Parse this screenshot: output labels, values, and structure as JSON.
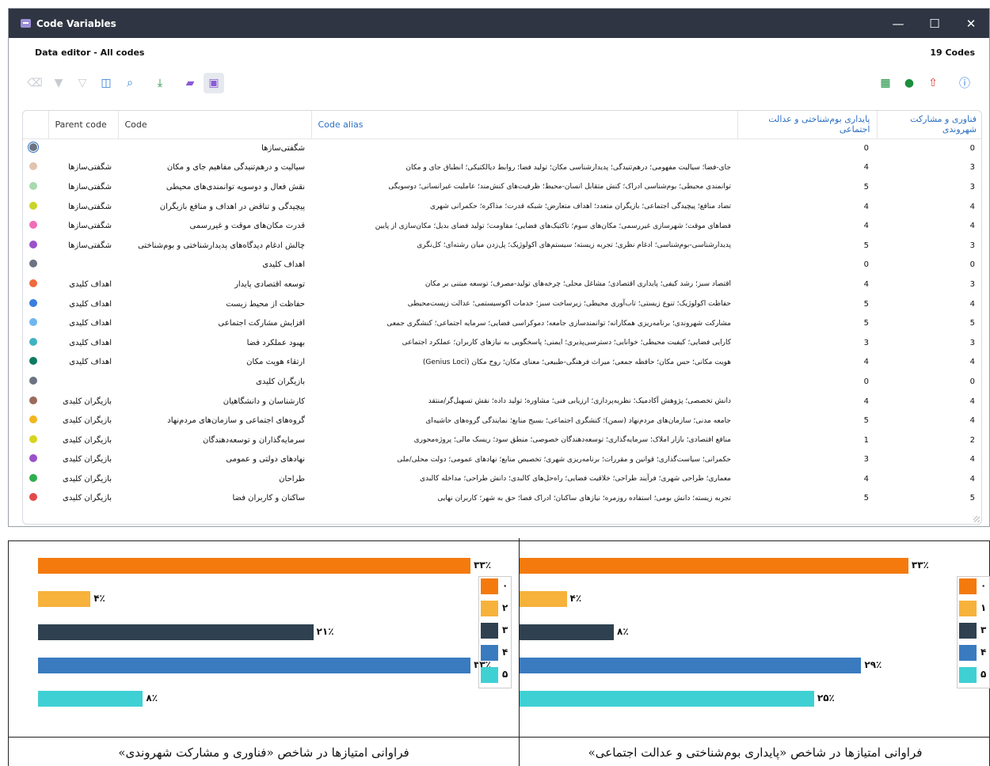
{
  "window": {
    "title": "Code Variables",
    "controls": {
      "minimize": "—",
      "maximize": "☐",
      "close": "✕"
    }
  },
  "header": {
    "subtitle": "Data editor - All codes",
    "count": "19 Codes"
  },
  "toolbar": {
    "left_icons": [
      "eraser-icon",
      "filter-icon",
      "filter-clear-icon",
      "columns-icon",
      "search-icon",
      "download-icon",
      "tag-icon",
      "table-view-icon"
    ],
    "right_icons": [
      "excel-icon",
      "web-icon",
      "export-icon",
      "info-icon"
    ]
  },
  "table": {
    "columns": {
      "parent": "Parent code",
      "code": "Code",
      "alias": "Code alias",
      "col4": "پایداری بوم‌شناختی و عدالت اجتماعی",
      "col5": "فناوری و مشارکت شهروندی"
    },
    "rows": [
      {
        "color": "#6b7480",
        "parent": "",
        "code": "شگفتی‌سازها",
        "alias": "",
        "v1": "0",
        "v2": "0"
      },
      {
        "color": "#e3c3b0",
        "parent": "شگفتی‌سازها",
        "code": "سیالیت و درهم‌تنیدگی مفاهیم جای و مکان",
        "alias": "جای-فضا؛ سیالیت مفهومی؛ درهم‌تنیدگی؛ پدیدارشناسی مکان؛ تولید فضا؛ روابط دیالکتیکی؛ انطباق جای و مکان",
        "v1": "4",
        "v2": "3"
      },
      {
        "color": "#a9d9b0",
        "parent": "شگفتی‌سازها",
        "code": "نقش فعال و دوسویه توانمندی‌های محیطی",
        "alias": "توانمندی محیطی؛ بوم‌شناسی ادراک؛ کنش متقابل انسان-محیط؛ ظرفیت‌های کنش‌مند؛ عاملیت غیرانسانی؛ دوسویگی",
        "v1": "5",
        "v2": "3"
      },
      {
        "color": "#c9d42a",
        "parent": "شگفتی‌سازها",
        "code": "پیچیدگی و تناقض در اهداف و منافع بازیگران",
        "alias": "تضاد منافع؛ پیچیدگی اجتماعی؛ بازیگران متعدد؛ اهداف متعارض؛ شبکه قدرت؛ مذاکره؛ حکمرانی شهری",
        "v1": "4",
        "v2": "4"
      },
      {
        "color": "#ef6fb6",
        "parent": "شگفتی‌سازها",
        "code": "قدرت مکان‌های موقت و غیررسمی",
        "alias": "فضاهای موقت؛ شهرسازی غیررسمی؛ مکان‌های سوم؛ تاکتیک‌های فضایی؛ مقاومت؛ تولید فضای بدیل؛ مکان‌سازی از پایین",
        "v1": "4",
        "v2": "4"
      },
      {
        "color": "#9b51c9",
        "parent": "شگفتی‌سازها",
        "code": "چالش ادغام دیدگاه‌های پدیدارشناختی و بوم‌شناختی",
        "alias": "پدیدارشناسی-بوم‌شناسی؛ ادغام نظری؛ تجربه زیسته؛ سیستم‌های اکولوژیک؛ پل‌زدن میان رشته‌ای؛ کل‌نگری",
        "v1": "5",
        "v2": "3"
      },
      {
        "color": "#6b7480",
        "parent": "",
        "code": "اهداف کلیدی",
        "alias": "",
        "v1": "0",
        "v2": "0"
      },
      {
        "color": "#f06a3d",
        "parent": "اهداف کلیدی",
        "code": "توسعه اقتصادی پایدار",
        "alias": "اقتصاد سبز؛ رشد کیفی؛ پایداری اقتصادی؛ مشاغل محلی؛ چرخه‌های تولید-مصرف؛ توسعه مبتنی بر مکان",
        "v1": "4",
        "v2": "3"
      },
      {
        "color": "#3b7de0",
        "parent": "اهداف کلیدی",
        "code": "حفاظت از محیط زیست",
        "alias": "حفاظت اکولوژیک؛ تنوع زیستی؛ تاب‌آوری محیطی؛ زیرساخت سبز؛ خدمات اکوسیستمی؛ عدالت زیست‌محیطی",
        "v1": "5",
        "v2": "4"
      },
      {
        "color": "#6fb6ef",
        "parent": "اهداف کلیدی",
        "code": "افزایش مشارکت اجتماعی",
        "alias": "مشارکت شهروندی؛ برنامه‌ریزی همکارانه؛ توانمندسازی جامعه؛ دموکراسی فضایی؛ سرمایه اجتماعی؛ کنشگری جمعی",
        "v1": "5",
        "v2": "5"
      },
      {
        "color": "#3fb3c0",
        "parent": "اهداف کلیدی",
        "code": "بهبود عملکرد فضا",
        "alias": "کارایی فضایی؛ کیفیت محیطی؛ خوانایی؛ دسترسی‌پذیری؛ ایمنی؛ پاسخگویی به نیازهای کاربران؛ عملکرد اجتماعی",
        "v1": "3",
        "v2": "3"
      },
      {
        "color": "#0e7a61",
        "parent": "اهداف کلیدی",
        "code": "ارتقاء هویت مکان",
        "alias": "هویت مکانی؛ حس مکان؛ حافظه جمعی؛ میراث فرهنگی-طبیعی؛ معنای مکان؛ روح مکان (Genius Loci)",
        "v1": "4",
        "v2": "4"
      },
      {
        "color": "#6b7480",
        "parent": "",
        "code": "بازیگران کلیدی",
        "alias": "",
        "v1": "0",
        "v2": "0"
      },
      {
        "color": "#9a6b5a",
        "parent": "بازیگران کلیدی",
        "code": "کارشناسان و دانشگاهیان",
        "alias": "دانش تخصصی؛ پژوهش آکادمیک؛ نظریه‌پردازی؛ ارزیابی فنی؛ مشاوره؛ تولید داده؛ نقش تسهیل‌گر/منتقد",
        "v1": "4",
        "v2": "4"
      },
      {
        "color": "#f2b61f",
        "parent": "بازیگران کلیدی",
        "code": "گروه‌های اجتماعی و سازمان‌های مردم‌نهاد",
        "alias": "جامعه مدنی؛ سازمان‌های مردم‌نهاد (سمن)؛ کنشگری اجتماعی؛ بسیج منابع؛ نمایندگی گروه‌های حاشیه‌ای",
        "v1": "5",
        "v2": "4"
      },
      {
        "color": "#d8d41f",
        "parent": "بازیگران کلیدی",
        "code": "سرمایه‌گذاران و توسعه‌دهندگان",
        "alias": "منافع اقتصادی؛ بازار املاک؛ سرمایه‌گذاری؛ توسعه‌دهندگان خصوصی؛ منطق سود؛ ریسک مالی؛ پروژه‌محوری",
        "v1": "1",
        "v2": "2"
      },
      {
        "color": "#9b51c9",
        "parent": "بازیگران کلیدی",
        "code": "نهادهای دولتی و عمومی",
        "alias": "حکمرانی؛ سیاست‌گذاری؛ قوانین و مقررات؛ برنامه‌ریزی شهری؛ تخصیص منابع؛ نهادهای عمومی؛ دولت محلی/ملی",
        "v1": "3",
        "v2": "4"
      },
      {
        "color": "#2fae4f",
        "parent": "بازیگران کلیدی",
        "code": "طراحان",
        "alias": "معماری؛ طراحی شهری؛ فرآیند طراحی؛ خلاقیت فضایی؛ راه‌حل‌های کالبدی؛ دانش طراحی؛ مداخله کالبدی",
        "v1": "4",
        "v2": "4"
      },
      {
        "color": "#e24a4a",
        "parent": "بازیگران کلیدی",
        "code": "ساکنان و کاربران فضا",
        "alias": "تجربه زیسته؛ دانش بومی؛ استفاده روزمره؛ نیازهای ساکنان؛ ادراک فضا؛ حق به شهر؛ کاربران نهایی",
        "v1": "5",
        "v2": "5"
      }
    ]
  },
  "chart_data": [
    {
      "type": "bar",
      "orientation": "horizontal",
      "title": "فراوانی امتیازها در شاخص «فناوری و مشارکت شهروندی»",
      "categories": [
        "۰",
        "۲",
        "۳",
        "۴",
        "۵"
      ],
      "values": [
        33,
        4,
        21,
        33,
        8
      ],
      "value_labels": [
        "۳۳٪",
        "۴٪",
        "۲۱٪",
        "۳۳٪",
        "۸٪"
      ],
      "colors": [
        "#f47a0e",
        "#f7b23b",
        "#2f4150",
        "#3a7bc0",
        "#3fd0d4"
      ],
      "legend": "right",
      "xlim": [
        0,
        40
      ]
    },
    {
      "type": "bar",
      "orientation": "horizontal",
      "title": "فراوانی امتیازها در شاخص «پایداری بوم‌شناختی و عدالت اجتماعی»",
      "categories": [
        "۰",
        "۱",
        "۳",
        "۴",
        "۵"
      ],
      "values": [
        33,
        4,
        8,
        29,
        25
      ],
      "value_labels": [
        "۳۳٪",
        "۴٪",
        "۸٪",
        "۲۹٪",
        "۲۵٪"
      ],
      "colors": [
        "#f47a0e",
        "#f7b23b",
        "#2f4150",
        "#3a7bc0",
        "#3fd0d4"
      ],
      "legend": "right",
      "xlim": [
        0,
        40
      ]
    }
  ]
}
